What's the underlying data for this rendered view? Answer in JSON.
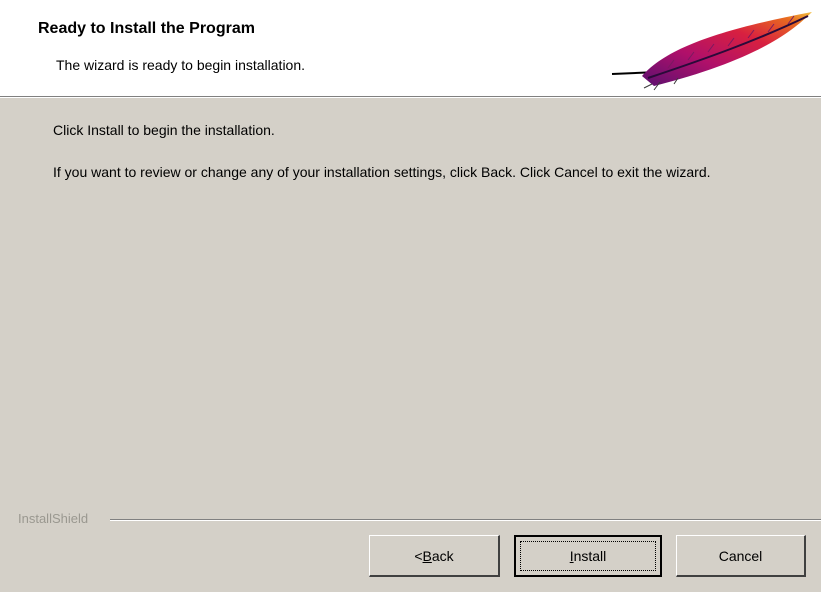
{
  "header": {
    "title": "Ready to Install the Program",
    "subtitle": "The wizard is ready to begin installation.",
    "logo_icon": "feather-icon"
  },
  "body": {
    "line1": "Click Install to begin the installation.",
    "line2": "If you want to review or change any of your installation settings, click Back. Click Cancel to exit the wizard."
  },
  "footer": {
    "brand": "InstallShield"
  },
  "buttons": {
    "back": {
      "prefix": "< ",
      "mnemonic": "B",
      "rest": "ack"
    },
    "install": {
      "mnemonic": "I",
      "rest": "nstall"
    },
    "cancel": {
      "label": "Cancel"
    }
  },
  "colors": {
    "dialog_bg": "#d4d0c8",
    "header_bg": "#ffffff",
    "brand_text": "#9a9890"
  }
}
